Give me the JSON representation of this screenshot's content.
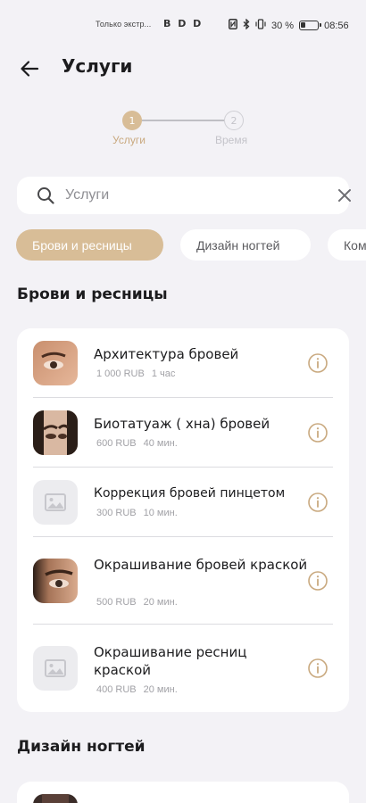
{
  "status_bar": {
    "carrier": "Только экстр...",
    "icons": "B  D D",
    "battery": "30 %",
    "time": "08:56",
    "battery_level": 0.3
  },
  "header": {
    "title": "Услуги"
  },
  "stepper": {
    "steps": [
      {
        "number": "1",
        "label": "Услуги",
        "active": true
      },
      {
        "number": "2",
        "label": "Время",
        "active": false
      }
    ]
  },
  "search": {
    "placeholder": "Услуги"
  },
  "categories": [
    {
      "label": "Брови и ресницы",
      "active": true
    },
    {
      "label": "Дизайн ногтей",
      "active": false
    },
    {
      "label": "Ком",
      "active": false
    }
  ],
  "sections": [
    {
      "title": "Брови и ресницы",
      "services": [
        {
          "name": "Архитектура бровей",
          "price": "1 000 RUB",
          "duration": "1 час",
          "thumb": "photo"
        },
        {
          "name": "Биотатуаж ( хна) бровей",
          "price": "600 RUB",
          "duration": "40 мин.",
          "thumb": "photo"
        },
        {
          "name": "Коррекция бровей пинцетом",
          "price": "300 RUB",
          "duration": "10 мин.",
          "thumb": "placeholder"
        },
        {
          "name": "Окрашивание бровей краской",
          "price": "500 RUB",
          "duration": "20 мин.",
          "thumb": "photo"
        },
        {
          "name": "Окрашивание ресниц краской",
          "price": "400 RUB",
          "duration": "20 мин.",
          "thumb": "placeholder"
        }
      ]
    },
    {
      "title": "Дизайн ногтей",
      "services": []
    }
  ],
  "colors": {
    "accent": "#d8bd97",
    "background": "#f3f2f6",
    "card": "#ffffff",
    "muted_text": "#a1a1a6",
    "info_icon": "#c9a97f"
  },
  "icons": {
    "back": "arrow-left-icon",
    "search": "search-icon",
    "clear": "close-icon",
    "info": "info-icon",
    "placeholder": "image-placeholder-icon"
  }
}
